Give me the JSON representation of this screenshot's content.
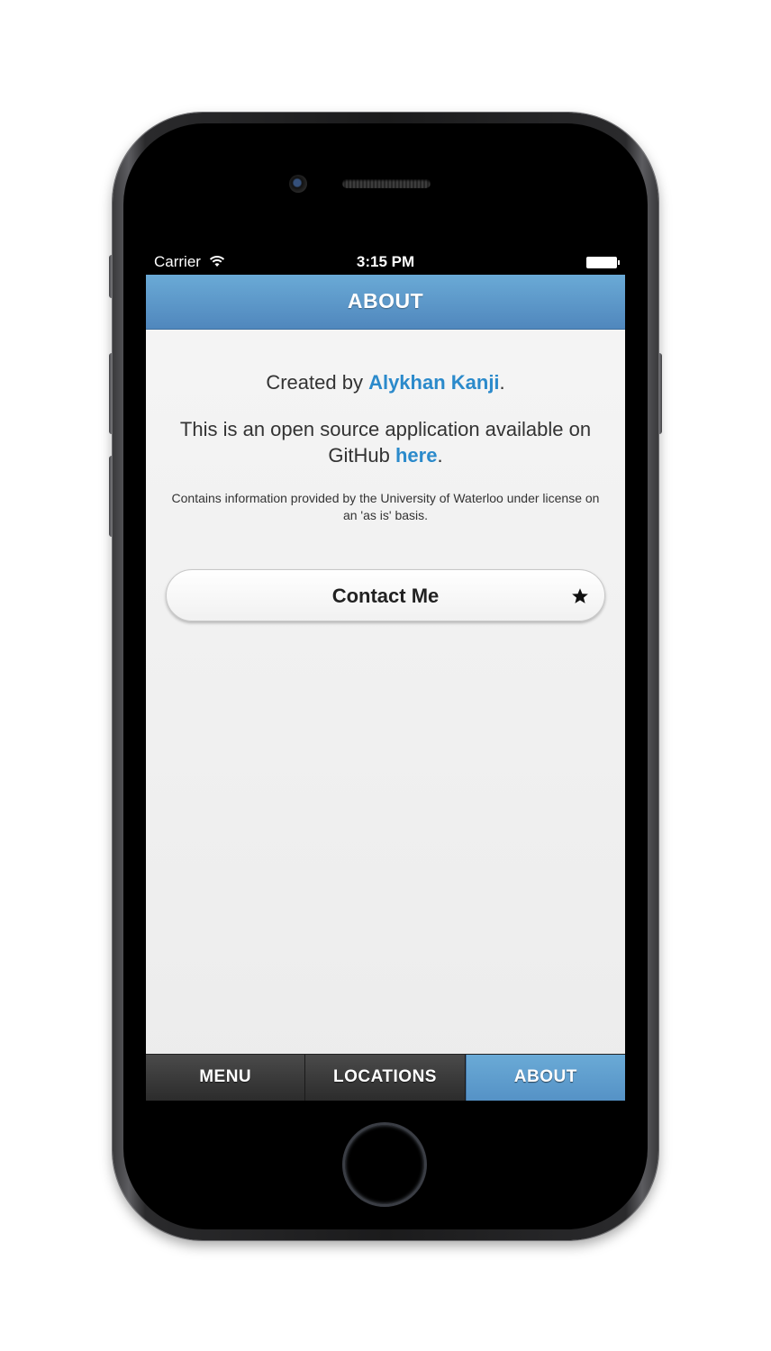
{
  "status_bar": {
    "carrier": "Carrier",
    "time": "3:15 PM",
    "wifi_icon": "wifi-icon",
    "battery_icon": "battery-icon"
  },
  "header": {
    "title": "ABOUT"
  },
  "content": {
    "created_prefix": "Created by ",
    "author_link": "Alykhan Kanji",
    "created_suffix": ".",
    "opensource_text": "This is an open source application available on GitHub ",
    "github_link": "here",
    "opensource_suffix": ".",
    "license_text": "Contains information provided by the University of Waterloo under license on an 'as is' basis."
  },
  "contact_button": {
    "label": "Contact Me",
    "icon": "star-icon"
  },
  "tabs": [
    {
      "label": "MENU",
      "active": false
    },
    {
      "label": "LOCATIONS",
      "active": false
    },
    {
      "label": "ABOUT",
      "active": true
    }
  ],
  "colors": {
    "accent": "#5a9acb",
    "link": "#2b8acb",
    "tab_bar": "#3a3a3a"
  }
}
